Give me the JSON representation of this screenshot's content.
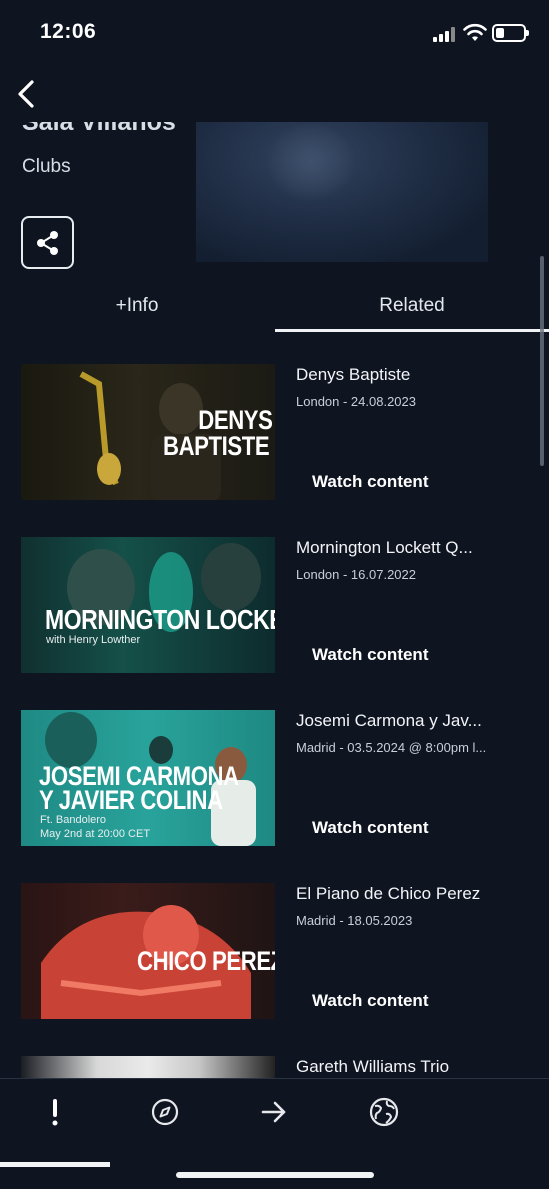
{
  "status_bar": {
    "time": "12:06",
    "battery_level": 0.25
  },
  "venue": {
    "title": "Sala Villanos",
    "category": "Clubs"
  },
  "tabs": [
    {
      "label": "+Info",
      "selected": false
    },
    {
      "label": "Related",
      "selected": true
    }
  ],
  "related": [
    {
      "title": "Denys Baptiste",
      "meta": "London - 24.08.2023",
      "watch_label": "Watch content",
      "thumb_lines": [
        "DENYS",
        "BAPTISTE"
      ],
      "thumb_sub": ""
    },
    {
      "title": "Mornington Lockett Q...",
      "meta": "London - 16.07.2022",
      "watch_label": "Watch content",
      "thumb_lines": [
        "MORNINGTON LOCKETT"
      ],
      "thumb_sub": "with Henry Lowther"
    },
    {
      "title": "Josemi Carmona y Jav...",
      "meta": "Madrid - 03.5.2024 @ 8:00pm l...",
      "watch_label": "Watch content",
      "thumb_lines": [
        "JOSEMI CARMONA",
        "Y JAVIER COLINA"
      ],
      "thumb_sub": "Ft. Bandolero",
      "thumb_sub2": "May 2nd at 20:00 CET"
    },
    {
      "title": "El Piano de Chico Perez",
      "meta": "Madrid - 18.05.2023",
      "watch_label": "Watch content",
      "thumb_lines": [
        "CHICO PEREZ"
      ],
      "thumb_sub": ""
    },
    {
      "title": "Gareth Williams Trio",
      "meta": "",
      "watch_label": "",
      "thumb_lines": [],
      "thumb_sub": ""
    }
  ],
  "bottom_nav": [
    {
      "icon": "exclamation-icon",
      "selected": true
    },
    {
      "icon": "compass-icon",
      "selected": false
    },
    {
      "icon": "arrow-right-icon",
      "selected": false
    },
    {
      "icon": "globe-icon",
      "selected": false
    }
  ],
  "colors": {
    "background": "#0e1420",
    "text": "#ffffff",
    "thumb_teal": "#1b8f8a",
    "thumb_red": "#d8443a",
    "thumb_dark": "#1c1a14"
  }
}
